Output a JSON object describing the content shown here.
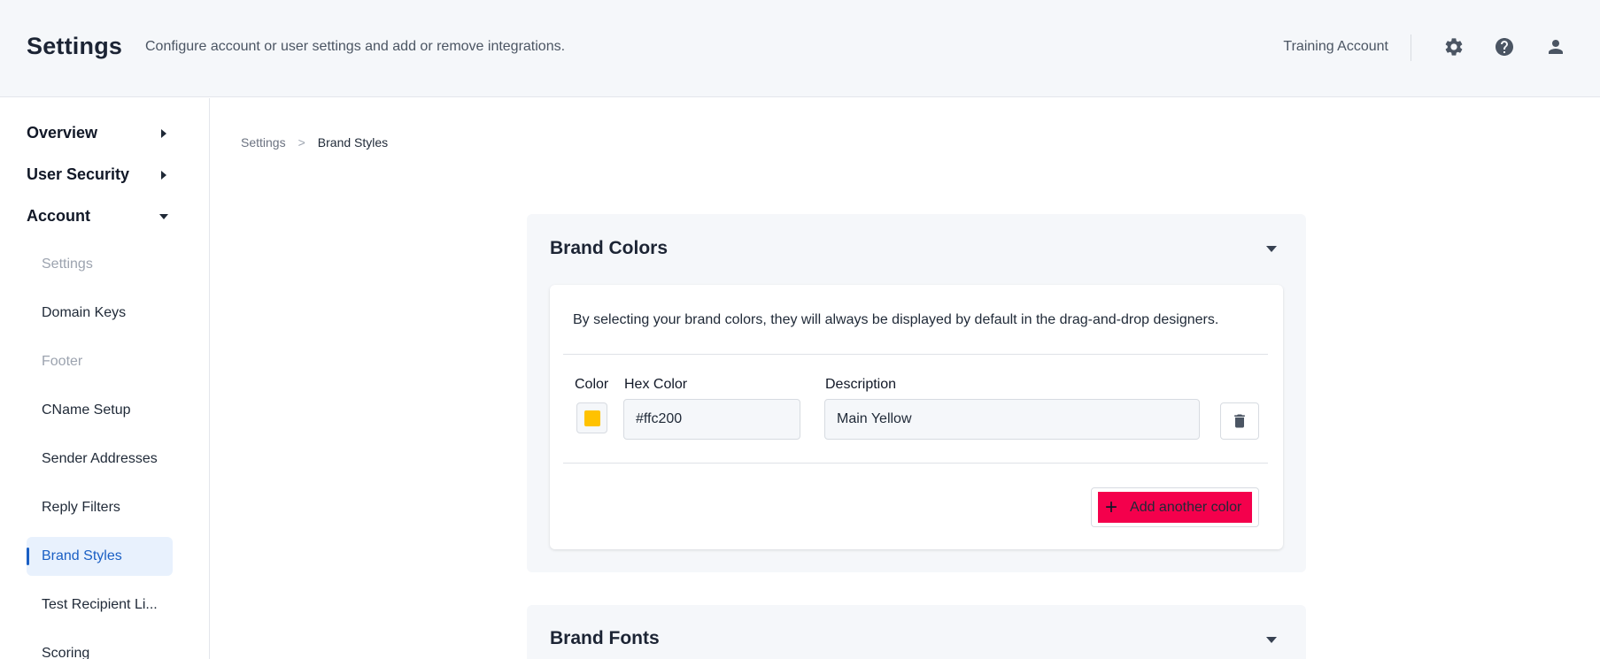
{
  "header": {
    "title": "Settings",
    "subtitle": "Configure account or user settings and add or remove integrations.",
    "account_name": "Training Account",
    "icons": [
      "gear-icon",
      "help-icon",
      "user-icon"
    ]
  },
  "sidebar": {
    "sections": [
      {
        "label": "Overview",
        "state": "collapsed"
      },
      {
        "label": "User Security",
        "state": "collapsed"
      },
      {
        "label": "Account",
        "state": "expanded"
      }
    ],
    "items": [
      {
        "label": "Settings",
        "state": "muted"
      },
      {
        "label": "Domain Keys",
        "state": "normal"
      },
      {
        "label": "Footer",
        "state": "muted"
      },
      {
        "label": "CName Setup",
        "state": "normal"
      },
      {
        "label": "Sender Addresses",
        "state": "normal"
      },
      {
        "label": "Reply Filters",
        "state": "normal"
      },
      {
        "label": "Brand Styles",
        "state": "active"
      },
      {
        "label": "Test Recipient Li...",
        "state": "normal"
      },
      {
        "label": "Scoring",
        "state": "normal"
      }
    ]
  },
  "breadcrumb": {
    "root": "Settings",
    "separator": ">",
    "current": "Brand Styles"
  },
  "brand_colors": {
    "title": "Brand Colors",
    "description": "By selecting your brand colors, they will always be displayed by default in the drag-and-drop designers.",
    "col_color": "Color",
    "col_hex": "Hex Color",
    "col_description": "Description",
    "rows": [
      {
        "swatch": "#ffc200",
        "hex": "#ffc200",
        "description": "Main Yellow"
      }
    ],
    "add_label": "Add another color",
    "add_button_color": "#f4004c"
  },
  "brand_fonts": {
    "title": "Brand Fonts"
  },
  "colors": {
    "accent": "#1a5fc4",
    "header_bg": "#f5f7fa"
  }
}
